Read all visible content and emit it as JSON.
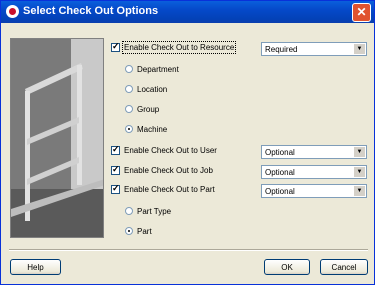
{
  "window": {
    "title": "Select Check Out Options",
    "close_glyph": "✕"
  },
  "options": {
    "resource": {
      "label": "Enable Check Out to Resource",
      "checked": true,
      "dropdown": "Required"
    },
    "radios_resource": [
      {
        "label": "Department",
        "selected": false
      },
      {
        "label": "Location",
        "selected": false
      },
      {
        "label": "Group",
        "selected": false
      },
      {
        "label": "Machine",
        "selected": true
      }
    ],
    "user": {
      "label": "Enable Check Out to User",
      "checked": true,
      "dropdown": "Optional"
    },
    "job": {
      "label": "Enable Check Out to Job",
      "checked": true,
      "dropdown": "Optional"
    },
    "part": {
      "label": "Enable Check Out to Part",
      "checked": true,
      "dropdown": "Optional"
    },
    "radios_part": [
      {
        "label": "Part Type",
        "selected": false
      },
      {
        "label": "Part",
        "selected": true
      }
    ]
  },
  "buttons": {
    "help": "Help",
    "ok": "OK",
    "cancel": "Cancel"
  },
  "icons": {
    "app": "app-icon",
    "close": "close-icon",
    "dropdown": "chevron-down-icon"
  }
}
